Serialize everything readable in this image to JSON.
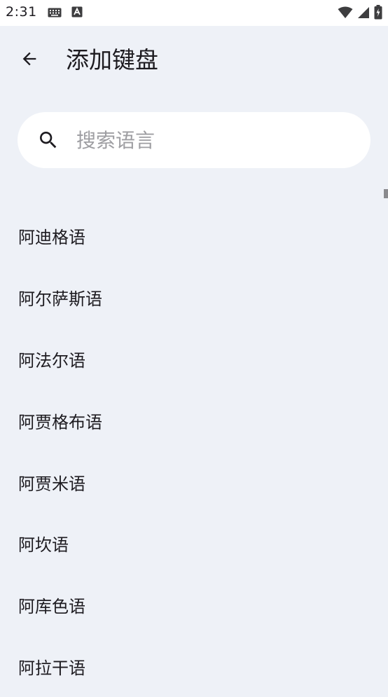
{
  "status_bar": {
    "time": "2:31",
    "icons": [
      "keyboard-icon",
      "a-icon",
      "wifi-icon",
      "signal-icon",
      "battery-icon"
    ]
  },
  "app_bar": {
    "title": "添加键盘",
    "back_icon": "arrow-left-icon"
  },
  "search": {
    "placeholder": "搜索语言",
    "value": ""
  },
  "languages": [
    "阿迪格语",
    "阿尔萨斯语",
    "阿法尔语",
    "阿贾格布语",
    "阿贾米语",
    "阿坎语",
    "阿库色语",
    "阿拉干语"
  ],
  "colors": {
    "background": "#eef1f7",
    "surface": "#ffffff",
    "text": "#1d1b20",
    "placeholder": "#9e9ea2"
  }
}
